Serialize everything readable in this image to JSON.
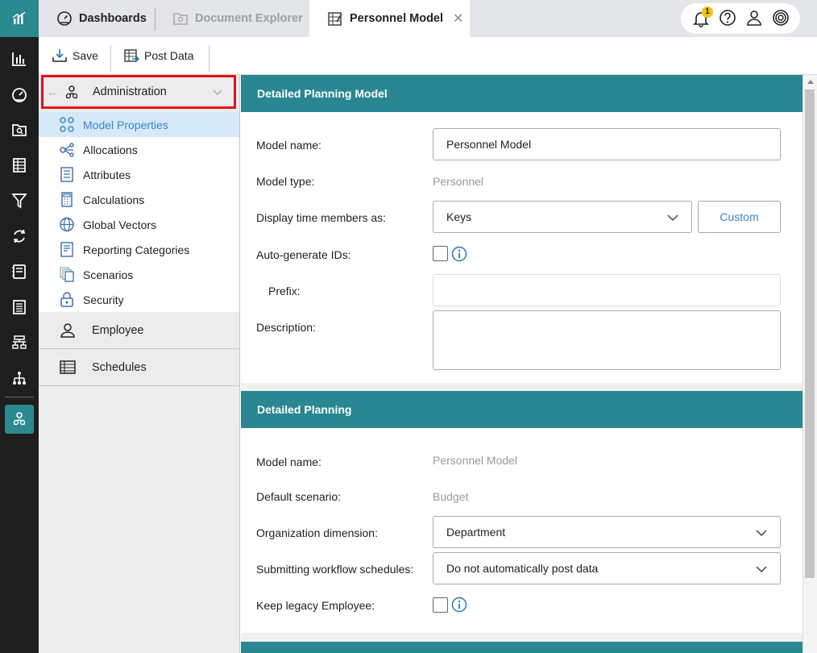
{
  "tabs": [
    {
      "label": "Dashboards"
    },
    {
      "label": "Document Explorer"
    },
    {
      "label": "Personnel Model"
    }
  ],
  "notifications": {
    "count": "1"
  },
  "toolbar": {
    "save_label": "Save",
    "post_label": "Post Data"
  },
  "nav": {
    "admin_label": "Administration",
    "items": [
      {
        "label": "Model Properties"
      },
      {
        "label": "Allocations"
      },
      {
        "label": "Attributes"
      },
      {
        "label": "Calculations"
      },
      {
        "label": "Global Vectors"
      },
      {
        "label": "Reporting Categories"
      },
      {
        "label": "Scenarios"
      },
      {
        "label": "Security"
      }
    ],
    "employee_label": "Employee",
    "schedules_label": "Schedules"
  },
  "panel1": {
    "title": "Detailed Planning Model",
    "model_name_label": "Model name:",
    "model_name_value": "Personnel Model",
    "model_type_label": "Model type:",
    "model_type_value": "Personnel",
    "display_time_label": "Display time members as:",
    "display_time_value": "Keys",
    "custom_label": "Custom",
    "autogen_label": "Auto-generate IDs:",
    "prefix_label": "Prefix:",
    "description_label": "Description:"
  },
  "panel2": {
    "title": "Detailed Planning",
    "model_name_label": "Model name:",
    "model_name_value": "Personnel Model",
    "default_scenario_label": "Default scenario:",
    "default_scenario_value": "Budget",
    "org_dim_label": "Organization dimension:",
    "org_dim_value": "Department",
    "submit_label": "Submitting workflow schedules:",
    "submit_value": "Do not automatically post data",
    "keep_legacy_label": "Keep legacy Employee:"
  },
  "colors": {
    "accent": "#2a8690",
    "highlight": "#e0101a",
    "link": "#3a86c8"
  }
}
